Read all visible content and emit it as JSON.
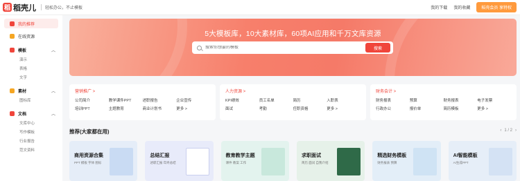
{
  "header": {
    "logo_mark": "稻",
    "logo_text": "稻壳儿",
    "slogan": "轻松办公，不止模板",
    "links": [
      "我的下载",
      "我的收藏"
    ],
    "cta": "稻壳会员 享特权"
  },
  "sidebar": {
    "active": "我的推荐",
    "favorites": "在线资源",
    "sections": [
      {
        "title": "模板",
        "color": "#f0453b",
        "subs": [
          "演示",
          "表格",
          "文字"
        ]
      },
      {
        "title": "素材",
        "color": "#f5a623",
        "subs": [
          "图标库"
        ]
      },
      {
        "title": "文档",
        "color": "#f0453b",
        "subs": [
          "文库中心",
          "写作模板",
          "行业报告",
          "范文资料"
        ]
      }
    ]
  },
  "banner": {
    "title": "5大模板库，10大素材库，60项AI应用和千万文库资源",
    "placeholder": "搜索你想要的模板",
    "search_button": "搜索"
  },
  "categories": [
    {
      "title": "营销推广 >",
      "links": [
        "公司简介",
        "教学课件PPT",
        "述职报告",
        "企业宣传",
        "培训PPT",
        "主题教育",
        "商业计划书",
        "更多 >"
      ]
    },
    {
      "title": "人力资源 >",
      "links": [
        "KPI绩效",
        "员工名单",
        "简历",
        "入职表",
        "面试",
        "考勤",
        "任职资格",
        "更多 >"
      ]
    },
    {
      "title": "财务会计 >",
      "links": [
        "财务报表",
        "预算",
        "财务报表",
        "电子发票",
        "行政办公",
        "报价单",
        "简历模板",
        "更多 >"
      ]
    }
  ],
  "recommend": {
    "title": "推荐(大家都在用)",
    "pager": "1 / 2",
    "cards": [
      {
        "name": "商用资源合集",
        "desc": "PPT 模板 字体 图标",
        "bg": "#e5edf8",
        "thumb": "#c9dbf3"
      },
      {
        "name": "总结汇报",
        "desc": "述职汇报 年终总结",
        "bg": "#e8ebfa",
        "thumb": "#ffffff"
      },
      {
        "name": "教育教学主题",
        "desc": "课件 教案 工作",
        "bg": "#e3f3ee",
        "thumb": "#c8e8dc"
      },
      {
        "name": "求职面试",
        "desc": "简历 面试 自我介绍",
        "bg": "#e6f1e9",
        "thumb": "#2f6a48"
      },
      {
        "name": "精选财务模板",
        "desc": "财务报表 预算",
        "bg": "#e3eef8",
        "thumb": "#cfe3f4"
      },
      {
        "name": "AI智能模板",
        "desc": "AI生成PPT",
        "bg": "#e6eef8",
        "thumb": "#d4e2f4"
      }
    ]
  }
}
